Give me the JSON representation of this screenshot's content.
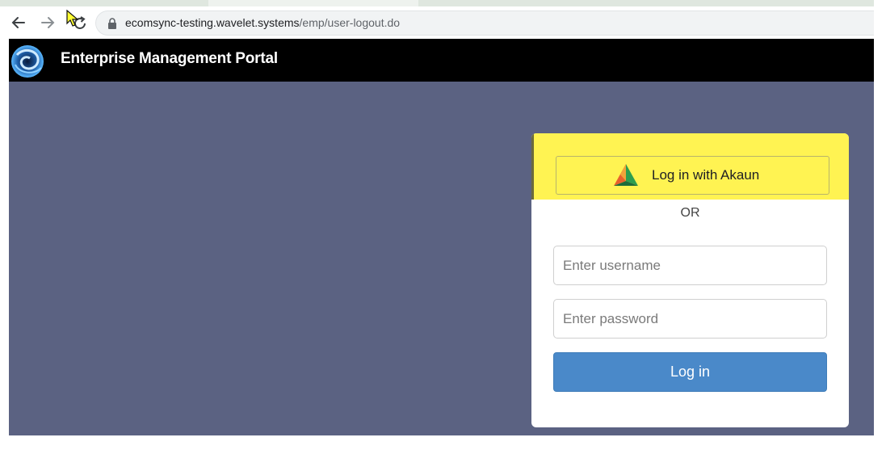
{
  "browser": {
    "url_host": "ecomsync-testing.wavelet.systems",
    "url_path": "/emp/user-logout.do",
    "back_icon": "back-arrow-icon",
    "forward_icon": "forward-arrow-icon",
    "reload_icon": "reload-icon",
    "lock_icon": "lock-icon"
  },
  "header": {
    "title": "Enterprise Management Portal",
    "logo_icon": "swirl-logo-icon",
    "background": "#000000"
  },
  "main": {
    "background": "#5b6282"
  },
  "login": {
    "sso_button_label": "Log in with Akaun",
    "sso_logo_icon": "akaun-logo-icon",
    "sso_band_color": "#fff352",
    "separator": "OR",
    "username_placeholder": "Enter username",
    "username_value": "",
    "password_placeholder": "Enter password",
    "password_value": "",
    "submit_label": "Log in",
    "submit_color": "#4a89c9"
  }
}
